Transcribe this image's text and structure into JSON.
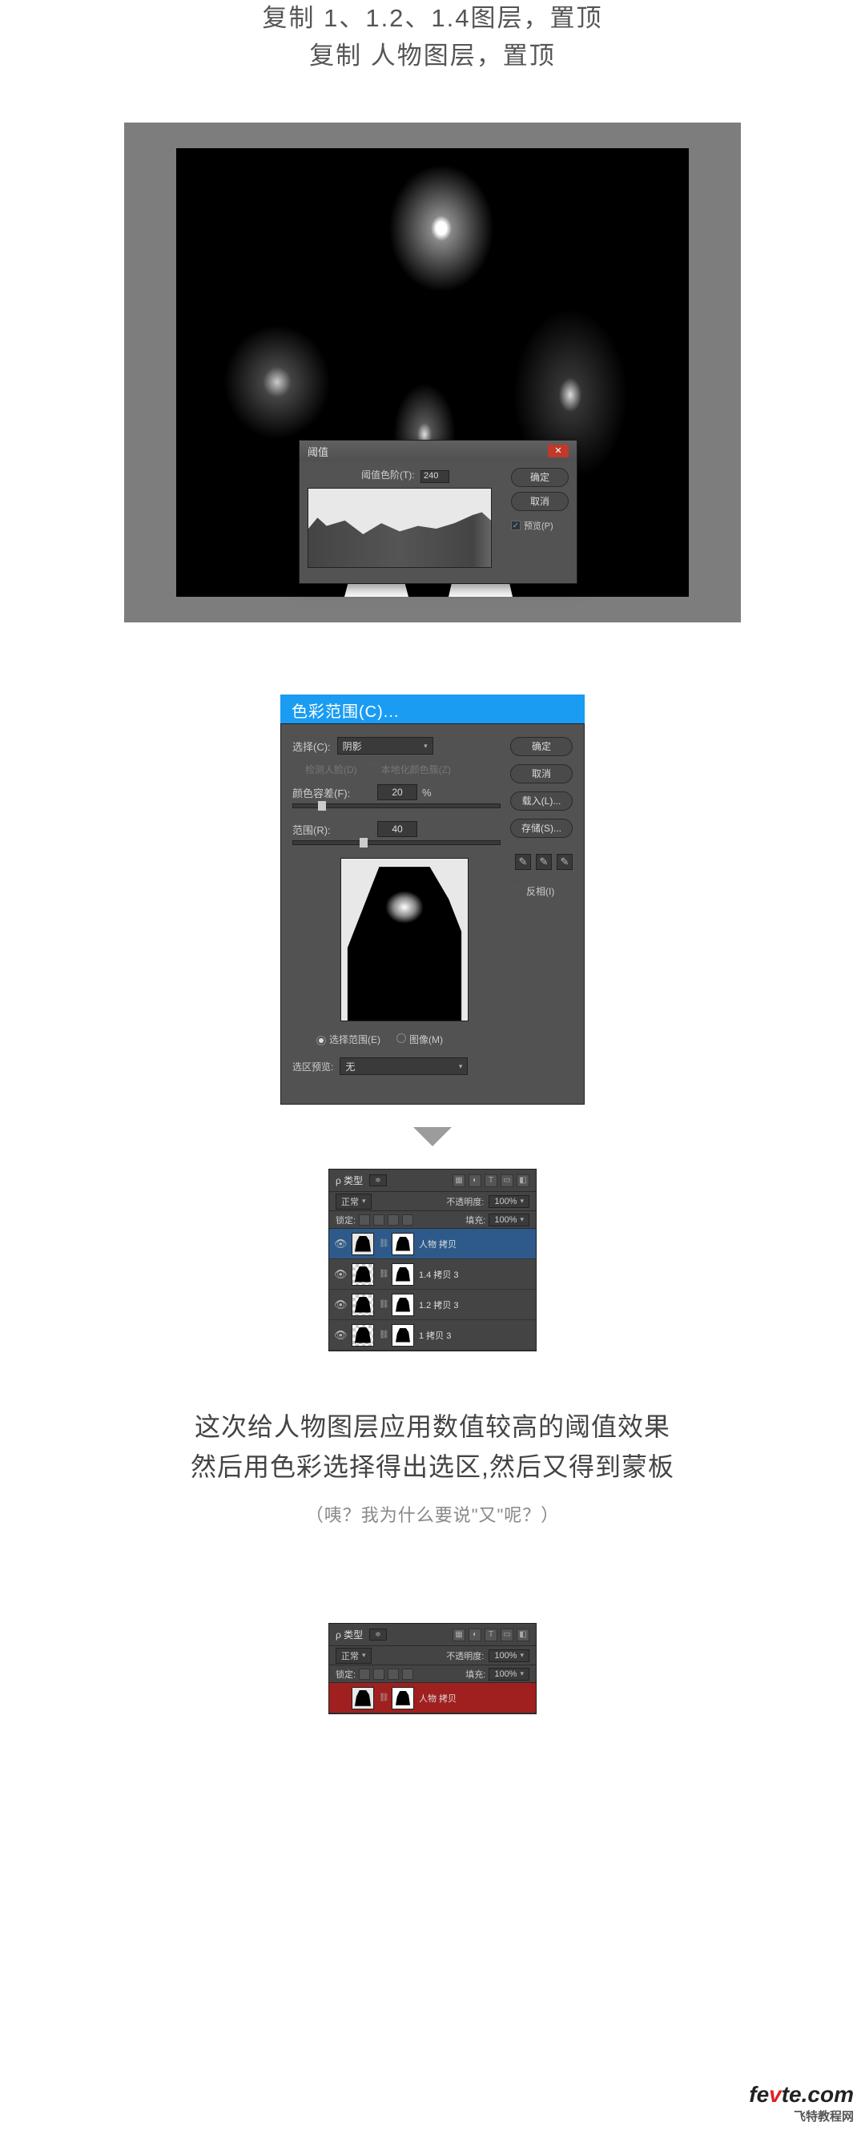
{
  "instruction": {
    "line1": "复制 1、1.2、1.4图层，置顶",
    "line2": "复制 人物图层，置顶"
  },
  "threshold": {
    "title": "阈值",
    "level_label": "阈值色阶(T):",
    "level_value": "240",
    "ok": "确定",
    "cancel": "取消",
    "preview": "预览(P)"
  },
  "color_range_header": "色彩范围(C)...",
  "color_range": {
    "select_label": "选择(C):",
    "select_value": "阴影",
    "detect_faces": "检测人脸(D)",
    "localized": "本地化颜色簇(Z)",
    "fuzziness_label": "颜色容差(F):",
    "fuzziness_value": "20",
    "fuzziness_pct": "%",
    "range_label": "范围(R):",
    "range_value": "40",
    "radio_selection": "选择范围(E)",
    "radio_image": "图像(M)",
    "preview_label": "选区预览:",
    "preview_value": "无",
    "ok": "确定",
    "cancel": "取消",
    "load": "载入(L)...",
    "save": "存储(S)...",
    "invert": "反相(I)"
  },
  "layers1": {
    "kind_label": "ρ 类型",
    "blend": "正常",
    "opacity_label": "不透明度:",
    "opacity_val": "100%",
    "lock_label": "锁定:",
    "fill_label": "填充:",
    "fill_val": "100%",
    "items": [
      {
        "name": "人物 拷贝"
      },
      {
        "name": "1.4 拷贝 3"
      },
      {
        "name": "1.2 拷贝 3"
      },
      {
        "name": "1 拷贝 3"
      }
    ]
  },
  "layers2": {
    "kind_label": "ρ 类型",
    "blend": "正常",
    "opacity_label": "不透明度:",
    "opacity_val": "100%",
    "lock_label": "锁定:",
    "fill_label": "填充:",
    "fill_val": "100%",
    "items": [
      {
        "name": "人物 拷贝"
      }
    ]
  },
  "explain": {
    "line1": "这次给人物图层应用数值较高的阈值效果",
    "line2": "然后用色彩选择得出选区,然后又得到蒙板",
    "sub": "（咦？我为什么要说\"又\"呢？）"
  },
  "watermark": {
    "brand_pre": "fe",
    "brand_mid": "v",
    "brand_post": "te",
    "dot": ".com",
    "sub": "飞特教程网"
  }
}
